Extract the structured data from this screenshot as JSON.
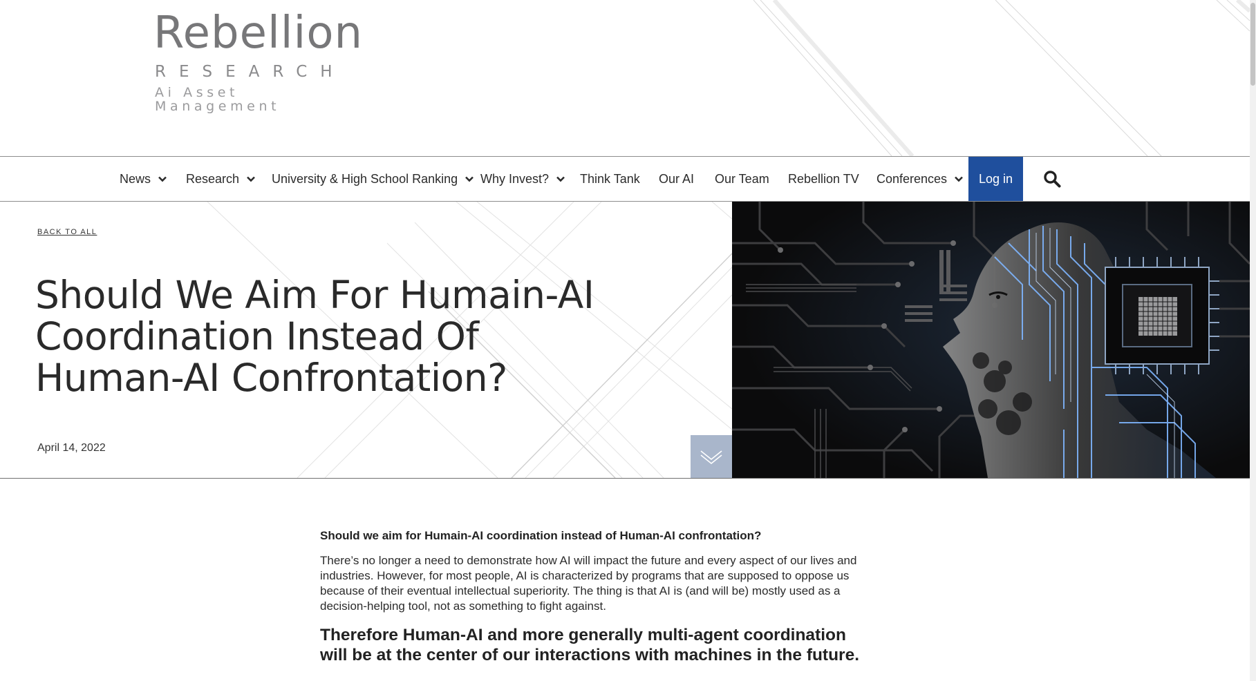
{
  "logo": {
    "main": "Rebellion",
    "sub": "RESEARCH",
    "tagline": "Ai Asset Management"
  },
  "nav": {
    "items": [
      {
        "label": "News",
        "dropdown": true
      },
      {
        "label": "Research",
        "dropdown": true
      },
      {
        "label": "University & High School Ranking",
        "dropdown": true
      },
      {
        "label": "Why Invest?",
        "dropdown": true
      },
      {
        "label": "Think Tank",
        "dropdown": false
      },
      {
        "label": "Our AI",
        "dropdown": false
      },
      {
        "label": "Our Team",
        "dropdown": false
      },
      {
        "label": "Rebellion TV",
        "dropdown": false
      },
      {
        "label": "Conferences",
        "dropdown": true
      }
    ],
    "login_label": "Log in",
    "search_icon": "search-icon"
  },
  "hero": {
    "back_label": "BACK TO ALL",
    "title": "Should We Aim For Humain-AI Coordination Instead Of Human-AI Confrontation?",
    "date": "April 14, 2022",
    "scroll_icon": "chevron-down-icon",
    "image_icon": "ai-circuit-face-image"
  },
  "article": {
    "lead": "Should we aim for Humain-AI coordination instead of Human-AI confrontation?",
    "paragraph": "There’s no longer a need to demonstrate how AI will impact the future and every aspect of our lives and industries. However, for most people, AI is characterized by programs that are supposed to oppose us because of their eventual intellectual superiority. The thing is that AI is (and will be) mostly used as a decision-helping tool, not as something to fight against.",
    "callout": "Therefore Human-AI and more generally multi-agent coordination will be at the center of our interactions with machines in the future."
  },
  "colors": {
    "login_bg": "#1f4f9d",
    "scroll_btn_bg": "#a9b6cb",
    "logo_gray": "#777779",
    "circuit_blue": "#7fb6ff"
  }
}
